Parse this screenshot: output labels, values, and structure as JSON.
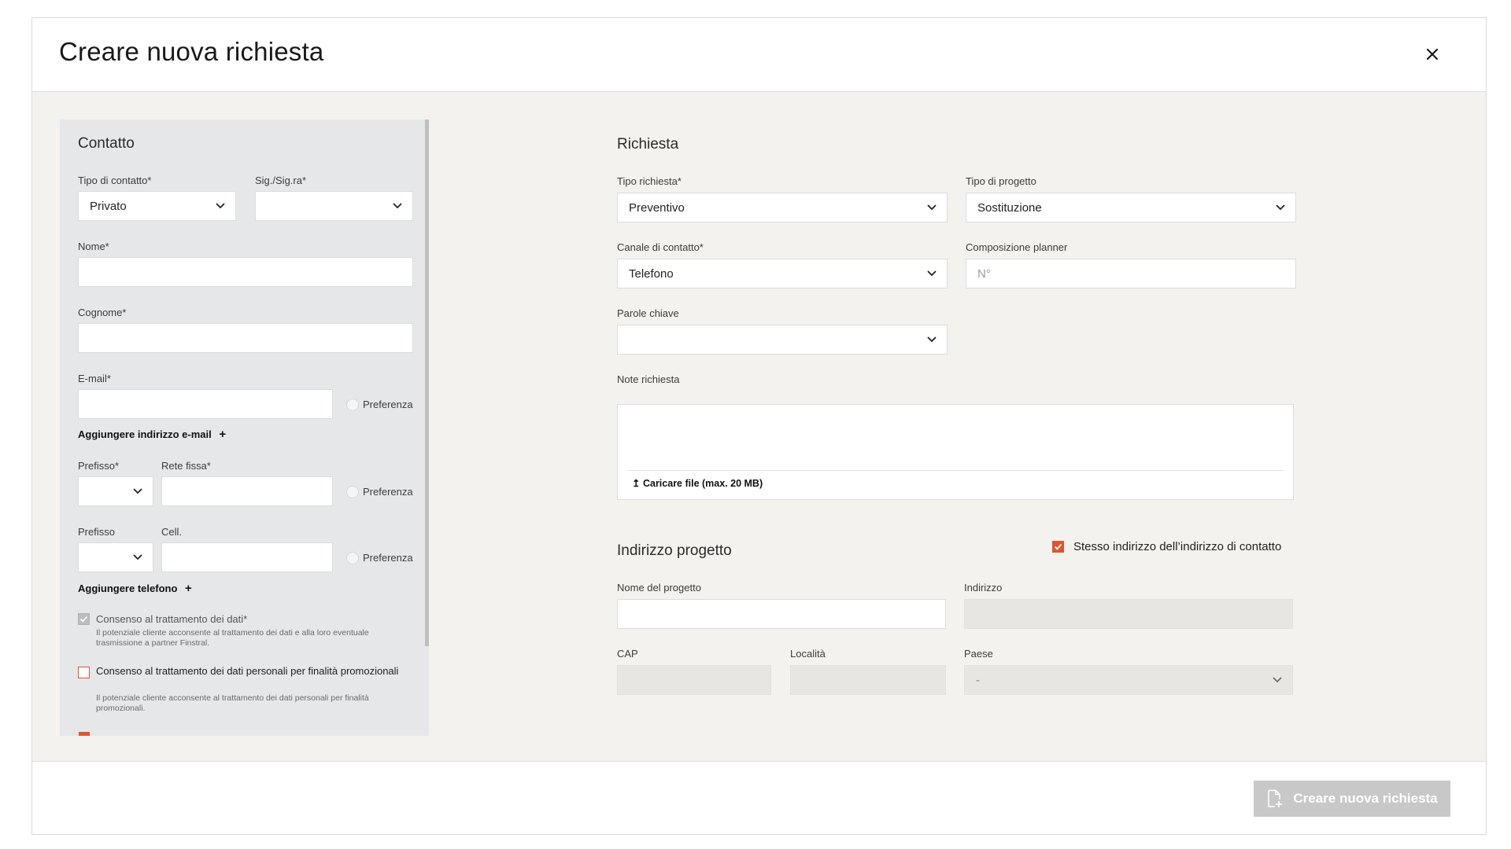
{
  "modal": {
    "title": "Creare nuova richiesta",
    "submit_label": "Creare nuova richiesta"
  },
  "contact": {
    "title": "Contatto",
    "tipo_contatto_label": "Tipo di contatto*",
    "tipo_contatto_value": "Privato",
    "sig_label": "Sig./Sig.ra*",
    "sig_value": "",
    "nome_label": "Nome*",
    "cognome_label": "Cognome*",
    "email_label": "E-mail*",
    "preferenza_label": "Preferenza",
    "add_email_label": "Aggiungere indirizzo e-mail",
    "prefisso_req_label": "Prefisso*",
    "rete_fissa_label": "Rete fissa*",
    "prefisso_label": "Prefisso",
    "cell_label": "Cell.",
    "add_phone_label": "Aggiungere telefono",
    "consent1_title": "Consenso al trattamento dei dati*",
    "consent1_desc": "Il potenziale cliente acconsente al trattamento dei dati e alla loro eventuale trasmissione a partner Finstral.",
    "consent2_title": "Consenso al trattamento dei dati personali per finalità promozionali",
    "consent2_desc": "Il potenziale cliente acconsente al trattamento dei dati personali per finalità promozionali."
  },
  "request": {
    "title": "Richiesta",
    "tipo_richiesta_label": "Tipo richiesta*",
    "tipo_richiesta_value": "Preventivo",
    "tipo_progetto_label": "Tipo di progetto",
    "tipo_progetto_value": "Sostituzione",
    "canale_label": "Canale di contatto*",
    "canale_value": "Telefono",
    "planner_label": "Composizione planner",
    "planner_placeholder": "N°",
    "parole_label": "Parole chiave",
    "note_label": "Note richiesta",
    "upload_label": "Caricare file (max. 20 MB)"
  },
  "project_address": {
    "title": "Indirizzo progetto",
    "same_address_label": "Stesso indirizzo dell’indirizzo di contatto",
    "same_address_checked": true,
    "nome_progetto_label": "Nome del progetto",
    "indirizzo_label": "Indirizzo",
    "cap_label": "CAP",
    "localita_label": "Località",
    "paese_label": "Paese",
    "paese_value": "-"
  },
  "colors": {
    "accent": "#e0542e",
    "panel_bg": "#e6e7e8",
    "modal_bg": "#f3f2ef",
    "button_disabled": "#c8c8c8"
  }
}
